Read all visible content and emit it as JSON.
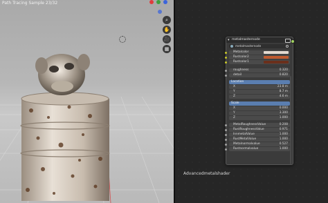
{
  "viewport": {
    "title": "Path Tracing Sample 23/32",
    "nav_icons": [
      "magnify-icon",
      "hand-icon",
      "camera-icon",
      "grid-icon"
    ],
    "nav_glyphs": [
      "⌕",
      "✋",
      "🎥",
      "▦"
    ]
  },
  "editor": {
    "label": "Advancedmetalshader"
  },
  "node": {
    "title": "metalmasternode",
    "node_tree": "metalmasternode",
    "rows": [
      {
        "type": "color",
        "label": "Metalcolor",
        "swatch": "#e2d9d0",
        "socket": "#c7c729"
      },
      {
        "type": "color",
        "label": "Rustcolor2",
        "swatch": "#c05a2e",
        "socket": "#c7c729"
      },
      {
        "type": "color",
        "label": "Rustcolor1",
        "swatch": "#6b2f1b",
        "socket": "#c7c729"
      },
      {
        "type": "value",
        "label": "roughness",
        "value": "0.320",
        "socket": "#a1a1a1"
      },
      {
        "type": "value",
        "label": "detail",
        "value": "0.820",
        "socket": "#a1a1a1"
      },
      {
        "type": "section",
        "label": "Location"
      },
      {
        "type": "value",
        "label": "X",
        "value": "23.8 m",
        "socket": ""
      },
      {
        "type": "value",
        "label": "Y",
        "value": "8.7 m",
        "socket": ""
      },
      {
        "type": "value",
        "label": "Z",
        "value": "4.6 m",
        "socket": ""
      },
      {
        "type": "section",
        "label": "Scale"
      },
      {
        "type": "value",
        "label": "X",
        "value": "0.000",
        "socket": ""
      },
      {
        "type": "value",
        "label": "Y",
        "value": "3.300",
        "socket": ""
      },
      {
        "type": "value",
        "label": "Z",
        "value": "1.000",
        "socket": ""
      },
      {
        "type": "value",
        "label": "MetalRoughnessValue",
        "value": "0.208",
        "socket": "#a1a1a1"
      },
      {
        "type": "value",
        "label": "RustRoughnessValue",
        "value": "0.971",
        "socket": "#a1a1a1"
      },
      {
        "type": "value",
        "label": "InnmetalValue",
        "value": "1.000",
        "socket": "#a1a1a1"
      },
      {
        "type": "value",
        "label": "RustMetalValue",
        "value": "1.000",
        "socket": "#a1a1a1"
      },
      {
        "type": "value",
        "label": "Metalnormalvalue",
        "value": "0.527",
        "socket": "#a1a1a1"
      },
      {
        "type": "value",
        "label": "Rustnormalvalue",
        "value": "1.000",
        "socket": "#a1a1a1"
      }
    ]
  },
  "colors": {
    "accent_section": "#5a7eb0",
    "gizmo": [
      "#e03c3c",
      "#3ca03c",
      "#3c64dc"
    ]
  }
}
